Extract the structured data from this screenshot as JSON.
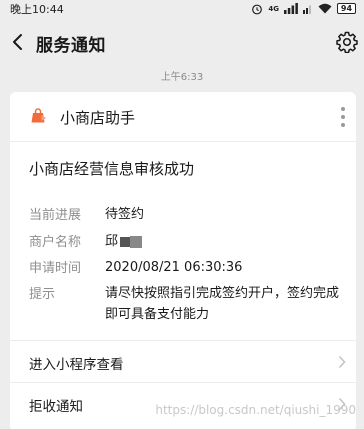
{
  "status_bar": {
    "time": "晚上10:44",
    "battery": "94",
    "network": "4G"
  },
  "nav": {
    "title": "服务通知",
    "back_icon": "back-arrow-icon",
    "settings_icon": "gear-icon"
  },
  "message": {
    "timestamp": "上午6:33",
    "app_name": "小商店助手",
    "notice_title": "小商店经营信息审核成功",
    "fields": [
      {
        "label": "当前进展",
        "value": "待签约"
      },
      {
        "label": "商户名称",
        "value": "邱"
      },
      {
        "label": "申请时间",
        "value": "2020/08/21 06:30:36"
      },
      {
        "label": "提示",
        "value": "请尽快按照指引完成签约开户，签约完成即可具备支付能力"
      }
    ],
    "actions": [
      {
        "label": "进入小程序查看"
      },
      {
        "label": "拒收通知"
      }
    ]
  },
  "watermark": "https://blog.csdn.net/qiushi_1990"
}
